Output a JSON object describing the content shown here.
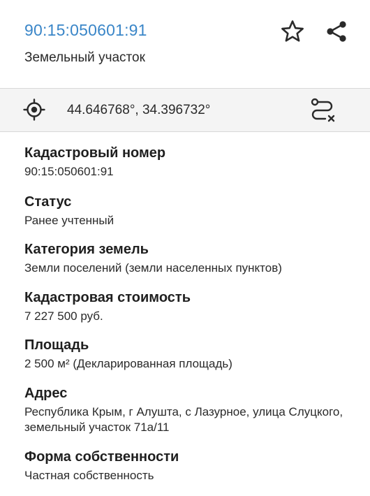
{
  "header": {
    "cadastral_link": "90:15:050601:91",
    "subtitle": "Земельный участок",
    "star_icon": "star-outline-icon",
    "share_icon": "share-icon"
  },
  "coordinates": {
    "locate_icon": "crosshair-icon",
    "text": "44.646768°, 34.396732°",
    "route_icon": "route-icon"
  },
  "fields": [
    {
      "label": "Кадастровый номер",
      "value": "90:15:050601:91"
    },
    {
      "label": "Статус",
      "value": "Ранее учтенный"
    },
    {
      "label": "Категория земель",
      "value": "Земли поселений (земли населенных пунктов)"
    },
    {
      "label": "Кадастровая стоимость",
      "value": "7 227 500 руб."
    },
    {
      "label": "Площадь",
      "value": "2 500 м² (Декларированная площадь)"
    },
    {
      "label": "Адрес",
      "value": "Республика Крым, г Алушта, с Лазурное, улица Слуцкого, земельный участок 71а/11"
    },
    {
      "label": "Форма собственности",
      "value": "Частная собственность"
    }
  ],
  "colors": {
    "link": "#3a86c8",
    "coord_row_bg": "#f4f4f4",
    "text": "#1f1f1f"
  }
}
